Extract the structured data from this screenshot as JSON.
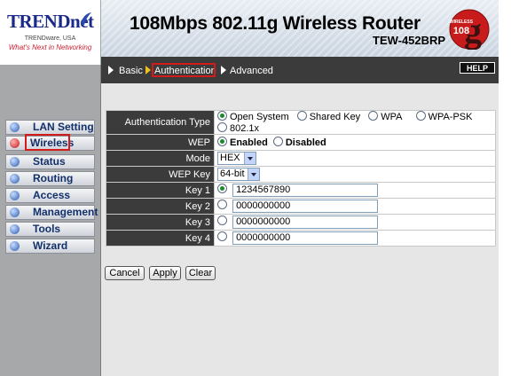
{
  "header": {
    "logo": "TRENDnet",
    "logo_sub": "TRENDware, USA",
    "logo_tagline": "What's Next in Networking",
    "product_title": "108Mbps 802.11g Wireless Router",
    "model": "TEW-452BRP",
    "badge_small": "WIRELESS",
    "badge_number": "108",
    "badge_letter": "g",
    "help_label": "HELP"
  },
  "nav": {
    "items": [
      {
        "label": "Basic"
      },
      {
        "label": "Authentication",
        "active": true
      },
      {
        "label": "Advanced"
      }
    ]
  },
  "sidebar": {
    "items": [
      {
        "label": "LAN Setting"
      },
      {
        "label": "Wireless",
        "active": true
      },
      {
        "label": "Status"
      },
      {
        "label": "Routing"
      },
      {
        "label": "Access"
      },
      {
        "label": "Management"
      },
      {
        "label": "Tools"
      },
      {
        "label": "Wizard"
      }
    ]
  },
  "form": {
    "auth_type": {
      "label": "Authentication Type",
      "options": [
        "Open System",
        "Shared Key",
        "WPA",
        "WPA-PSK",
        "802.1x"
      ],
      "selected": "Open System"
    },
    "wep": {
      "label": "WEP",
      "options": [
        "Enabled",
        "Disabled"
      ],
      "selected": "Enabled"
    },
    "mode": {
      "label": "Mode",
      "value": "HEX"
    },
    "wep_key": {
      "label": "WEP Key",
      "value": "64-bit"
    },
    "keys": [
      {
        "label": "Key 1",
        "value": "1234567890",
        "selected": true
      },
      {
        "label": "Key 2",
        "value": "0000000000",
        "selected": false
      },
      {
        "label": "Key 3",
        "value": "0000000000",
        "selected": false
      },
      {
        "label": "Key 4",
        "value": "0000000000",
        "selected": false
      }
    ]
  },
  "buttons": {
    "cancel": "Cancel",
    "apply": "Apply",
    "clear": "Clear"
  },
  "colors": {
    "nav_bg": "#3b3b3b",
    "sidebar_bg": "#a7a8aa",
    "highlight_box": "#d21b1b",
    "selected_radio": "#1a8a2a",
    "logo_blue": "#1a2a8a"
  }
}
